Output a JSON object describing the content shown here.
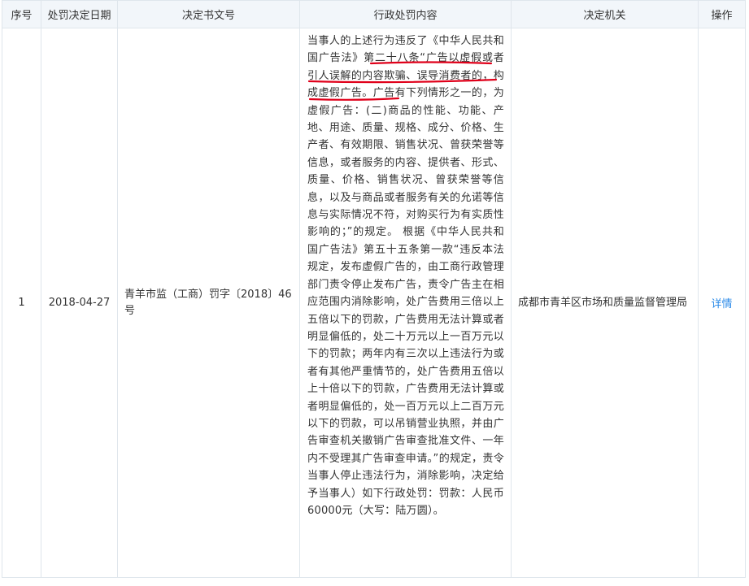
{
  "header": {
    "col_index": "序号",
    "col_date": "处罚决定日期",
    "col_doc": "决定书文号",
    "col_content": "行政处罚内容",
    "col_authority": "决定机关",
    "col_action": "操作"
  },
  "rows": [
    {
      "index": "1",
      "date": "2018-04-27",
      "doc_no": "青羊市监（工商）罚字〔2018〕46号",
      "content": "当事人的上述行为违反了《中华人民共和国广告法》第二十八条“广告以虚假或者引人误解的内容欺骗、误导消费者的，构成虚假广告。广告有下列情形之一的，为虚假广告：(二)商品的性能、功能、产地、用途、质量、规格、成分、价格、生产者、有效期限、销售状况、曾获荣誉等信息，或者服务的内容、提供者、形式、质量、价格、销售状况、曾获荣誉等信息，以及与商品或者服务有关的允诺等信息与实际情况不符，对购买行为有实质性影响的；”的规定。 根据《中华人民共和国广告法》第五十五条第一款“违反本法规定，发布虚假广告的，由工商行政管理部门责令停止发布广告，责令广告主在相应范围内消除影响，处广告费用三倍以上五倍以下的罚款，广告费用无法计算或者明显偏低的，处二十万元以上一百万元以下的罚款；两年内有三次以上违法行为或者有其他严重情节的，处广告费用五倍以上十倍以下的罚款，广告费用无法计算或者明显偏低的，处一百万元以上二百万元以下的罚款，可以吊销营业执照，并由广告审查机关撤销广告审查批准文件、一年内不受理其广告审查申请。”的规定，责令当事人停止违法行为，消除影响，决定给予当事人）如下行政处罚：罚款：人民币60000元（大写：陆万圆）。",
      "authority": "成都市青羊区市场和质量监督管理局",
      "action_label": "详情"
    }
  ],
  "colors": {
    "header_bg": "#f2f6fa",
    "border": "#dfe6ec",
    "link": "#2a8ae8",
    "annotation": "#e0001a"
  }
}
